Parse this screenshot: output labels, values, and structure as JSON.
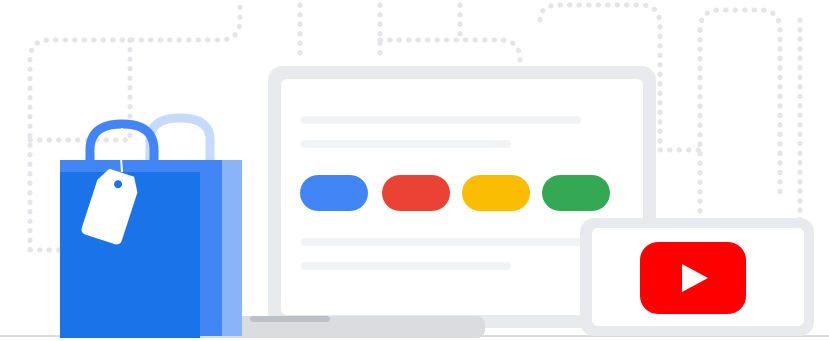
{
  "illustration": {
    "elements": [
      "shopping-bag",
      "price-tag",
      "laptop",
      "phone",
      "youtube-play-button"
    ]
  },
  "colors": {
    "background": "#ffffff",
    "dotted_outline": "#e8eaed",
    "bag_front": "#1a73e8",
    "bag_side": "#4285f4",
    "bag_handle_front": "#4285f4",
    "bag_handle_back": "#c6dafc",
    "tag": "#ffffff",
    "laptop_frame": "#e8eaed",
    "laptop_screen": "#ffffff",
    "laptop_base": "#dadce0",
    "text_line": "#f1f3f4",
    "pill_blue": "#4285f4",
    "pill_red": "#ea4335",
    "pill_yellow": "#fbbc04",
    "pill_green": "#34a853",
    "phone_frame": "#e8eaed",
    "youtube_red": "#ff0000",
    "play_white": "#ffffff"
  },
  "pills": [
    {
      "name": "pill-blue",
      "color": "#4285f4"
    },
    {
      "name": "pill-red",
      "color": "#ea4335"
    },
    {
      "name": "pill-yellow",
      "color": "#fbbc04"
    },
    {
      "name": "pill-green",
      "color": "#34a853"
    }
  ]
}
